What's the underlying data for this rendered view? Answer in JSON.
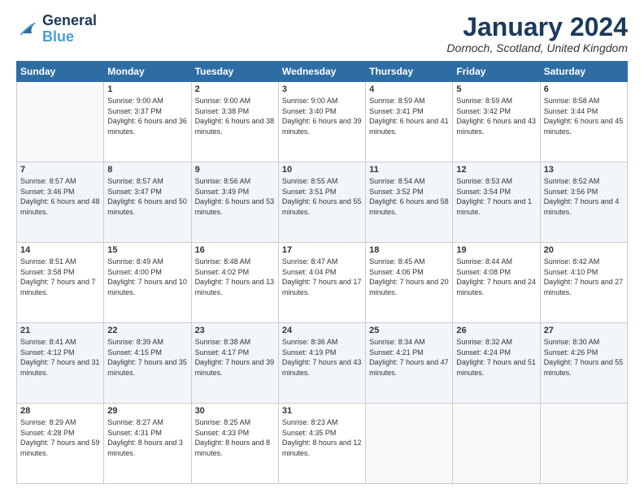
{
  "logo": {
    "line1": "General",
    "line2": "Blue"
  },
  "title": "January 2024",
  "location": "Dornoch, Scotland, United Kingdom",
  "days_of_week": [
    "Sunday",
    "Monday",
    "Tuesday",
    "Wednesday",
    "Thursday",
    "Friday",
    "Saturday"
  ],
  "weeks": [
    [
      {
        "day": "",
        "sunrise": "",
        "sunset": "",
        "daylight": ""
      },
      {
        "day": "1",
        "sunrise": "Sunrise: 9:00 AM",
        "sunset": "Sunset: 3:37 PM",
        "daylight": "Daylight: 6 hours and 36 minutes."
      },
      {
        "day": "2",
        "sunrise": "Sunrise: 9:00 AM",
        "sunset": "Sunset: 3:38 PM",
        "daylight": "Daylight: 6 hours and 38 minutes."
      },
      {
        "day": "3",
        "sunrise": "Sunrise: 9:00 AM",
        "sunset": "Sunset: 3:40 PM",
        "daylight": "Daylight: 6 hours and 39 minutes."
      },
      {
        "day": "4",
        "sunrise": "Sunrise: 8:59 AM",
        "sunset": "Sunset: 3:41 PM",
        "daylight": "Daylight: 6 hours and 41 minutes."
      },
      {
        "day": "5",
        "sunrise": "Sunrise: 8:59 AM",
        "sunset": "Sunset: 3:42 PM",
        "daylight": "Daylight: 6 hours and 43 minutes."
      },
      {
        "day": "6",
        "sunrise": "Sunrise: 8:58 AM",
        "sunset": "Sunset: 3:44 PM",
        "daylight": "Daylight: 6 hours and 45 minutes."
      }
    ],
    [
      {
        "day": "7",
        "sunrise": "Sunrise: 8:57 AM",
        "sunset": "Sunset: 3:46 PM",
        "daylight": "Daylight: 6 hours and 48 minutes."
      },
      {
        "day": "8",
        "sunrise": "Sunrise: 8:57 AM",
        "sunset": "Sunset: 3:47 PM",
        "daylight": "Daylight: 6 hours and 50 minutes."
      },
      {
        "day": "9",
        "sunrise": "Sunrise: 8:56 AM",
        "sunset": "Sunset: 3:49 PM",
        "daylight": "Daylight: 6 hours and 53 minutes."
      },
      {
        "day": "10",
        "sunrise": "Sunrise: 8:55 AM",
        "sunset": "Sunset: 3:51 PM",
        "daylight": "Daylight: 6 hours and 55 minutes."
      },
      {
        "day": "11",
        "sunrise": "Sunrise: 8:54 AM",
        "sunset": "Sunset: 3:52 PM",
        "daylight": "Daylight: 6 hours and 58 minutes."
      },
      {
        "day": "12",
        "sunrise": "Sunrise: 8:53 AM",
        "sunset": "Sunset: 3:54 PM",
        "daylight": "Daylight: 7 hours and 1 minute."
      },
      {
        "day": "13",
        "sunrise": "Sunrise: 8:52 AM",
        "sunset": "Sunset: 3:56 PM",
        "daylight": "Daylight: 7 hours and 4 minutes."
      }
    ],
    [
      {
        "day": "14",
        "sunrise": "Sunrise: 8:51 AM",
        "sunset": "Sunset: 3:58 PM",
        "daylight": "Daylight: 7 hours and 7 minutes."
      },
      {
        "day": "15",
        "sunrise": "Sunrise: 8:49 AM",
        "sunset": "Sunset: 4:00 PM",
        "daylight": "Daylight: 7 hours and 10 minutes."
      },
      {
        "day": "16",
        "sunrise": "Sunrise: 8:48 AM",
        "sunset": "Sunset: 4:02 PM",
        "daylight": "Daylight: 7 hours and 13 minutes."
      },
      {
        "day": "17",
        "sunrise": "Sunrise: 8:47 AM",
        "sunset": "Sunset: 4:04 PM",
        "daylight": "Daylight: 7 hours and 17 minutes."
      },
      {
        "day": "18",
        "sunrise": "Sunrise: 8:45 AM",
        "sunset": "Sunset: 4:06 PM",
        "daylight": "Daylight: 7 hours and 20 minutes."
      },
      {
        "day": "19",
        "sunrise": "Sunrise: 8:44 AM",
        "sunset": "Sunset: 4:08 PM",
        "daylight": "Daylight: 7 hours and 24 minutes."
      },
      {
        "day": "20",
        "sunrise": "Sunrise: 8:42 AM",
        "sunset": "Sunset: 4:10 PM",
        "daylight": "Daylight: 7 hours and 27 minutes."
      }
    ],
    [
      {
        "day": "21",
        "sunrise": "Sunrise: 8:41 AM",
        "sunset": "Sunset: 4:12 PM",
        "daylight": "Daylight: 7 hours and 31 minutes."
      },
      {
        "day": "22",
        "sunrise": "Sunrise: 8:39 AM",
        "sunset": "Sunset: 4:15 PM",
        "daylight": "Daylight: 7 hours and 35 minutes."
      },
      {
        "day": "23",
        "sunrise": "Sunrise: 8:38 AM",
        "sunset": "Sunset: 4:17 PM",
        "daylight": "Daylight: 7 hours and 39 minutes."
      },
      {
        "day": "24",
        "sunrise": "Sunrise: 8:36 AM",
        "sunset": "Sunset: 4:19 PM",
        "daylight": "Daylight: 7 hours and 43 minutes."
      },
      {
        "day": "25",
        "sunrise": "Sunrise: 8:34 AM",
        "sunset": "Sunset: 4:21 PM",
        "daylight": "Daylight: 7 hours and 47 minutes."
      },
      {
        "day": "26",
        "sunrise": "Sunrise: 8:32 AM",
        "sunset": "Sunset: 4:24 PM",
        "daylight": "Daylight: 7 hours and 51 minutes."
      },
      {
        "day": "27",
        "sunrise": "Sunrise: 8:30 AM",
        "sunset": "Sunset: 4:26 PM",
        "daylight": "Daylight: 7 hours and 55 minutes."
      }
    ],
    [
      {
        "day": "28",
        "sunrise": "Sunrise: 8:29 AM",
        "sunset": "Sunset: 4:28 PM",
        "daylight": "Daylight: 7 hours and 59 minutes."
      },
      {
        "day": "29",
        "sunrise": "Sunrise: 8:27 AM",
        "sunset": "Sunset: 4:31 PM",
        "daylight": "Daylight: 8 hours and 3 minutes."
      },
      {
        "day": "30",
        "sunrise": "Sunrise: 8:25 AM",
        "sunset": "Sunset: 4:33 PM",
        "daylight": "Daylight: 8 hours and 8 minutes."
      },
      {
        "day": "31",
        "sunrise": "Sunrise: 8:23 AM",
        "sunset": "Sunset: 4:35 PM",
        "daylight": "Daylight: 8 hours and 12 minutes."
      },
      {
        "day": "",
        "sunrise": "",
        "sunset": "",
        "daylight": ""
      },
      {
        "day": "",
        "sunrise": "",
        "sunset": "",
        "daylight": ""
      },
      {
        "day": "",
        "sunrise": "",
        "sunset": "",
        "daylight": ""
      }
    ]
  ]
}
